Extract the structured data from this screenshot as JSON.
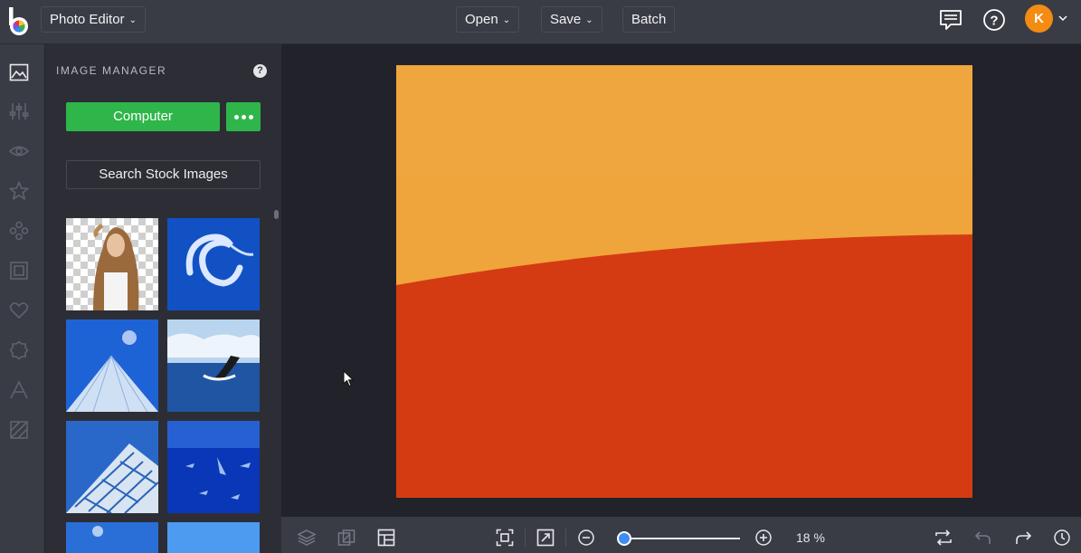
{
  "header": {
    "app_selector": "Photo Editor",
    "menu": {
      "open": "Open",
      "save": "Save",
      "batch": "Batch"
    },
    "avatar_initial": "K"
  },
  "toolrail": {
    "icons": [
      "image-manager-icon",
      "adjust-sliders-icon",
      "eye-icon",
      "star-icon",
      "graphics-icon",
      "frame-icon",
      "heart-icon",
      "badge-icon",
      "text-icon",
      "texture-icon"
    ],
    "active": "image-manager-icon"
  },
  "panel": {
    "title": "IMAGE MANAGER",
    "help": "?",
    "computer_button": "Computer",
    "search_button": "Search Stock Images",
    "thumbnails": [
      "woman-transparent",
      "jellyfish",
      "glass-building-sky",
      "whale-tail",
      "glass-facade",
      "shark-school",
      "blue-sky-1",
      "blue-sky-2"
    ]
  },
  "canvas": {
    "colors": {
      "top": "#f0a43c",
      "bottom": "#d53b12"
    }
  },
  "zoom": {
    "value": "18 %",
    "level": 0.05
  },
  "colors": {
    "accent_green": "#2fb64a",
    "avatar_orange": "#f48b12",
    "zoom_blue": "#3d8df2"
  }
}
